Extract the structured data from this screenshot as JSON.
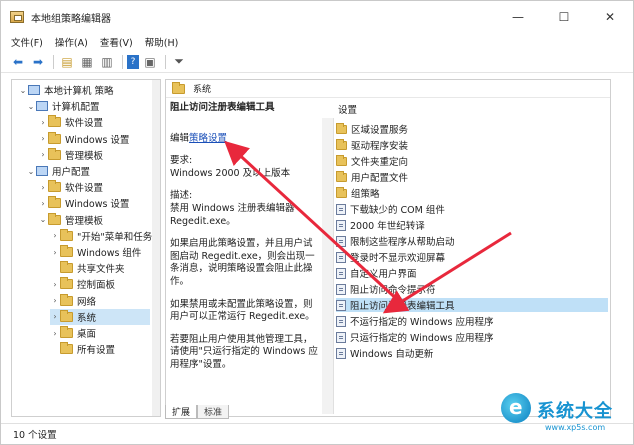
{
  "window": {
    "title": "本地组策略编辑器",
    "controls": {
      "minimize": "—",
      "maximize": "☐",
      "close": "✕"
    }
  },
  "menu": [
    "文件(F)",
    "操作(A)",
    "查看(V)",
    "帮助(H)"
  ],
  "tree": {
    "items": [
      {
        "label": "本地计算机 策略",
        "level": 0,
        "icon": "computer-icon",
        "expanded": true
      },
      {
        "label": "计算机配置",
        "level": 1,
        "icon": "computer-icon",
        "expanded": true
      },
      {
        "label": "软件设置",
        "level": 2,
        "icon": "folder-icon",
        "expanded": false
      },
      {
        "label": "Windows 设置",
        "level": 2,
        "icon": "folder-icon",
        "expanded": false
      },
      {
        "label": "管理模板",
        "level": 2,
        "icon": "folder-icon",
        "expanded": false
      },
      {
        "label": "用户配置",
        "level": 1,
        "icon": "user-icon",
        "expanded": true
      },
      {
        "label": "软件设置",
        "level": 2,
        "icon": "folder-icon",
        "expanded": false
      },
      {
        "label": "Windows 设置",
        "level": 2,
        "icon": "folder-icon",
        "expanded": false
      },
      {
        "label": "管理模板",
        "level": 2,
        "icon": "folder-icon",
        "expanded": true
      },
      {
        "label": "\"开始\"菜单和任务",
        "level": 3,
        "icon": "folder-icon",
        "expanded": false
      },
      {
        "label": "Windows 组件",
        "level": 3,
        "icon": "folder-icon",
        "expanded": false
      },
      {
        "label": "共享文件夹",
        "level": 3,
        "icon": "folder-icon",
        "expanded": false
      },
      {
        "label": "控制面板",
        "level": 3,
        "icon": "folder-icon",
        "expanded": false
      },
      {
        "label": "网络",
        "level": 3,
        "icon": "folder-icon",
        "expanded": false
      },
      {
        "label": "系统",
        "level": 3,
        "icon": "folder-icon",
        "expanded": false,
        "selected": true
      },
      {
        "label": "桌面",
        "level": 3,
        "icon": "folder-icon",
        "expanded": false
      },
      {
        "label": "所有设置",
        "level": 3,
        "icon": "folder-icon",
        "expanded": false
      }
    ]
  },
  "right_header": "系统",
  "description": {
    "title": "阻止访问注册表编辑工具",
    "edit_prefix": "编辑",
    "edit_link": "策略设置",
    "requirements_label": "要求:",
    "requirements_value": "Windows 2000 及以上版本",
    "desc_label": "描述:",
    "desc_text": "禁用 Windows 注册表编辑器 Regedit.exe。",
    "para1": "如果启用此策略设置，并且用户试图启动 Regedit.exe，则会出现一条消息，说明策略设置会阻止此操作。",
    "para2": "如果禁用或未配置此策略设置，则用户可以正常运行 Regedit.exe。",
    "para3": "若要阻止用户使用其他管理工具，请使用\"只运行指定的 Windows 应用程序\"设置。"
  },
  "settings_header": "设置",
  "settings": [
    {
      "label": "区域设置服务",
      "type": "folder"
    },
    {
      "label": "驱动程序安装",
      "type": "folder"
    },
    {
      "label": "文件夹重定向",
      "type": "folder"
    },
    {
      "label": "用户配置文件",
      "type": "folder"
    },
    {
      "label": "组策略",
      "type": "folder"
    },
    {
      "label": "下载缺少的 COM 组件",
      "type": "setting"
    },
    {
      "label": "2000 年世纪转译",
      "type": "setting"
    },
    {
      "label": "限制这些程序从帮助启动",
      "type": "setting"
    },
    {
      "label": "登录时不显示欢迎屏幕",
      "type": "setting"
    },
    {
      "label": "自定义用户界面",
      "type": "setting"
    },
    {
      "label": "阻止访问命令提示符",
      "type": "setting"
    },
    {
      "label": "阻止访问注册表编辑工具",
      "type": "setting",
      "selected": true
    },
    {
      "label": "不运行指定的 Windows 应用程序",
      "type": "setting"
    },
    {
      "label": "只运行指定的 Windows 应用程序",
      "type": "setting"
    },
    {
      "label": "Windows 自动更新",
      "type": "setting"
    }
  ],
  "tabs": [
    "扩展",
    "标准"
  ],
  "status": "10 个设置",
  "watermark": {
    "brand": "系统大全",
    "url": "www.xp5s.com"
  },
  "colors": {
    "arrow": "#e8283c",
    "selection": "#bfe0f7",
    "link": "#1a4fb8"
  }
}
